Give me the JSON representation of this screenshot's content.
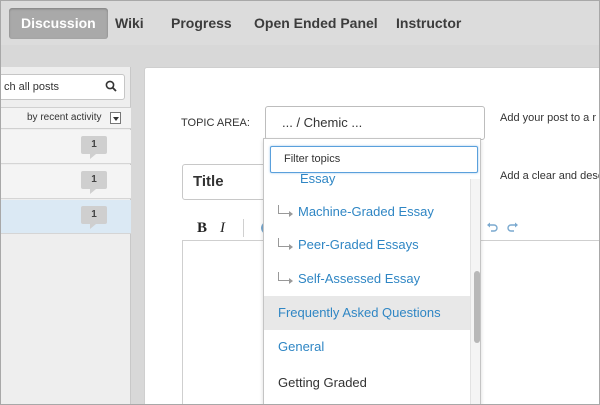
{
  "nav": {
    "tabs": [
      {
        "label": "Discussion",
        "active": true
      },
      {
        "label": "Wiki"
      },
      {
        "label": "Progress"
      },
      {
        "label": "Open Ended Panel"
      },
      {
        "label": "Instructor"
      }
    ]
  },
  "sidebar": {
    "search_text": "ch all posts",
    "sort_label": "by recent activity",
    "threads": [
      {
        "count": "1"
      },
      {
        "count": "1"
      },
      {
        "count": "1",
        "selected": true
      }
    ]
  },
  "form": {
    "topic_label": "TOPIC AREA:",
    "topic_value": "... / Chemic ...",
    "topic_help": "Add your post to a r",
    "title_placeholder": "Title",
    "title_help": "Add a clear and desc",
    "toolbar": {
      "bold": "B",
      "italic": "I"
    }
  },
  "dropdown": {
    "filter_placeholder": "Filter topics",
    "items": [
      {
        "label": "Essay",
        "kind": "child"
      },
      {
        "label": "Machine-Graded Essay",
        "kind": "child"
      },
      {
        "label": "Peer-Graded Essays",
        "kind": "child"
      },
      {
        "label": "Self-Assessed Essay",
        "kind": "child"
      },
      {
        "label": "Frequently Asked Questions",
        "kind": "blue",
        "hover": true
      },
      {
        "label": "General",
        "kind": "blue"
      },
      {
        "label": "Getting Graded",
        "kind": "plain"
      }
    ]
  },
  "colors": {
    "accent_blue": "#2f86c4",
    "active_tab": "#a9a9a9",
    "selected_thread": "#dbe9f4"
  }
}
